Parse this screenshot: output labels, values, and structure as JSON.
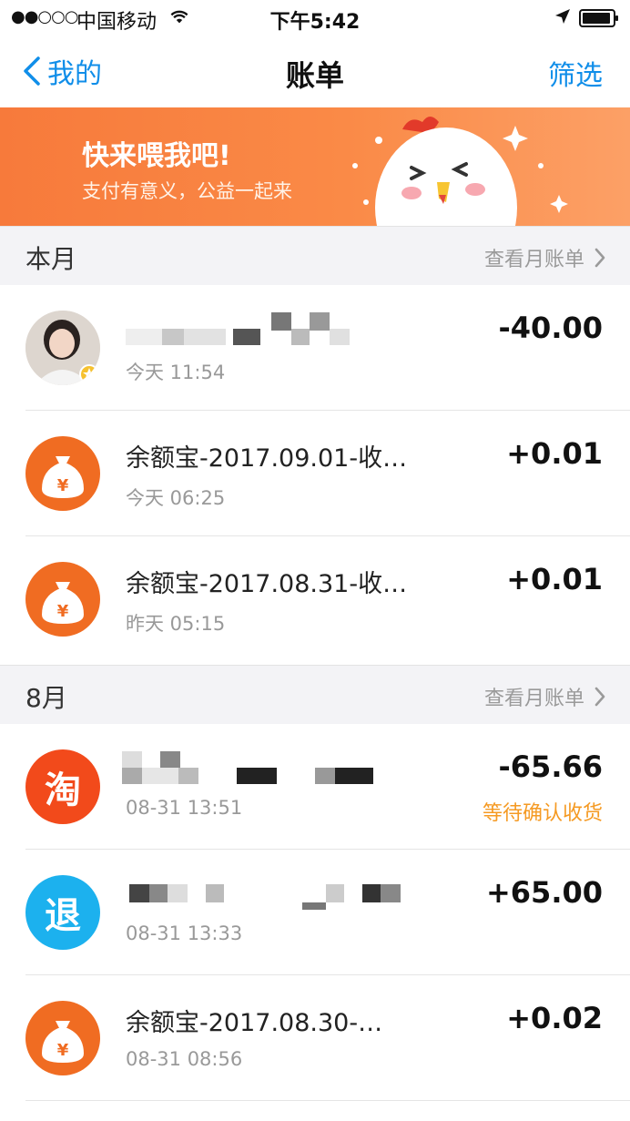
{
  "status_bar": {
    "signal": "●●○○○",
    "carrier": "中国移动",
    "time": "下午5:42"
  },
  "nav": {
    "back_label": "我的",
    "title": "账单",
    "filter_label": "筛选"
  },
  "banner": {
    "title": "快来喂我吧!",
    "subtitle": "支付有意义，公益一起来"
  },
  "sections": [
    {
      "title": "本月",
      "link": "查看月账单",
      "rows": [
        {
          "icon": "avatar-photo",
          "title": "",
          "time": "今天  11:54",
          "amount": "-40.00",
          "status": ""
        },
        {
          "icon": "money-bag-icon",
          "title": "余额宝-2017.09.01-收…",
          "time": "今天  06:25",
          "amount": "+0.01",
          "status": ""
        },
        {
          "icon": "money-bag-icon",
          "title": "余额宝-2017.08.31-收…",
          "time": "昨天  05:15",
          "amount": "+0.01",
          "status": ""
        }
      ]
    },
    {
      "title": "8月",
      "link": "查看月账单",
      "rows": [
        {
          "icon": "taobao-icon",
          "glyph": "淘",
          "title": "",
          "time": "08-31  13:51",
          "amount": "-65.66",
          "status": "等待确认收货"
        },
        {
          "icon": "refund-icon",
          "glyph": "退",
          "title": "",
          "time": "08-31  13:33",
          "amount": "+65.00",
          "status": ""
        },
        {
          "icon": "money-bag-icon",
          "title": "余额宝-2017.08.30-…",
          "time": "08-31  08:56",
          "amount": "+0.02",
          "status": ""
        }
      ]
    }
  ],
  "colors": {
    "accent_blue": "#108ee9",
    "banner_orange": "#f77a3b",
    "status_orange": "#f59a23",
    "yuebao_orange": "#f06c22",
    "taobao_red": "#f24a1b",
    "refund_blue": "#1cb1ee"
  }
}
